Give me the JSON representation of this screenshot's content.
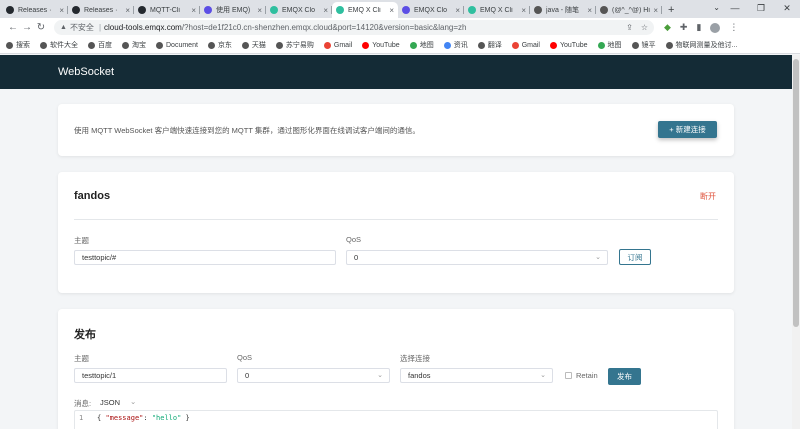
{
  "tabs": [
    {
      "label": "Releases ·",
      "fav_color": "#24292f",
      "fav_icon": "github-icon",
      "active": false
    },
    {
      "label": "Releases ·",
      "fav_color": "#24292f",
      "fav_icon": "github-icon",
      "active": false
    },
    {
      "label": "MQTT-Cli",
      "fav_color": "#24292f",
      "fav_icon": "github-icon",
      "active": false
    },
    {
      "label": "使用 EMQ)",
      "fav_color": "#5c4ee5",
      "fav_icon": "emqx-icon",
      "active": false
    },
    {
      "label": "EMQX Clo",
      "fav_color": "#2fbf9f",
      "fav_icon": "emqx-cloud-icon",
      "active": false
    },
    {
      "label": "EMQ X Cli",
      "fav_color": "#2fbf9f",
      "fav_icon": "emqx-cloud-icon",
      "active": true
    },
    {
      "label": "EMQX Clo",
      "fav_color": "#5c4ee5",
      "fav_icon": "emqx-icon",
      "active": false
    },
    {
      "label": "EMQ X Cli",
      "fav_color": "#2fbf9f",
      "fav_icon": "emqx-cloud-icon",
      "active": false
    },
    {
      "label": "java - 随笔",
      "fav_color": "#555555",
      "fav_icon": "page-icon",
      "active": false
    },
    {
      "label": "(@^_^@) Hi",
      "fav_color": "#555555",
      "fav_icon": "page-icon",
      "active": false
    }
  ],
  "tab_close": "×",
  "new_tab": "+",
  "window": {
    "minimize": "—",
    "maximize": "❐",
    "close": "✕",
    "tab_search": "⌄"
  },
  "address": {
    "not_secure": "不安全",
    "separator": "|",
    "host": "cloud-tools.emqx.com",
    "path": "/?host=de1f21c0.cn-shenzhen.emqx.cloud&port=14120&version=basic&lang=zh"
  },
  "bookmarks": [
    {
      "label": "搜索",
      "color": "#555555"
    },
    {
      "label": "软件大全",
      "color": "#555555"
    },
    {
      "label": "百度",
      "color": "#555555"
    },
    {
      "label": "淘宝",
      "color": "#555555"
    },
    {
      "label": "Document",
      "color": "#555555"
    },
    {
      "label": "京东",
      "color": "#555555"
    },
    {
      "label": "天猫",
      "color": "#555555"
    },
    {
      "label": "苏宁易购",
      "color": "#555555"
    },
    {
      "label": "Gmail",
      "color": "#ea4335"
    },
    {
      "label": "YouTube",
      "color": "#ff0000"
    },
    {
      "label": "地图",
      "color": "#34a853"
    },
    {
      "label": "资讯",
      "color": "#4285f4"
    },
    {
      "label": "翻译",
      "color": "#555555"
    },
    {
      "label": "Gmail",
      "color": "#ea4335"
    },
    {
      "label": "YouTube",
      "color": "#ff0000"
    },
    {
      "label": "地图",
      "color": "#34a853"
    },
    {
      "label": "镜平",
      "color": "#555555"
    },
    {
      "label": "物联网测量及他讨...",
      "color": "#555555"
    }
  ],
  "app": {
    "title": "WebSocket"
  },
  "intro": {
    "description": "使用 MQTT WebSocket 客户端快速连接到您的 MQTT 集群，通过图形化界面在线调试客户端间的通信。",
    "new_connection": "+ 新建连接"
  },
  "connection": {
    "name": "fandos",
    "disconnect": "断开",
    "topic_label": "主题",
    "topic_value": "testtopic/#",
    "qos_label": "QoS",
    "qos_value": "0",
    "subscribe": "订阅"
  },
  "publish": {
    "title": "发布",
    "topic_label": "主题",
    "topic_value": "testtopic/1",
    "qos_label": "QoS",
    "qos_value": "0",
    "conn_label": "选择连接",
    "conn_value": "fandos",
    "retain": "Retain",
    "publish_button": "发布",
    "message_label": "消息:",
    "format": "JSON",
    "line_number": "1",
    "payload_open": "{ ",
    "payload_key": "\"message\"",
    "payload_colon": ": ",
    "payload_val": "\"hello\"",
    "payload_close": " }"
  },
  "colors": {
    "header_bg": "#142b36",
    "accent": "#34758f",
    "danger": "#e0553f"
  }
}
